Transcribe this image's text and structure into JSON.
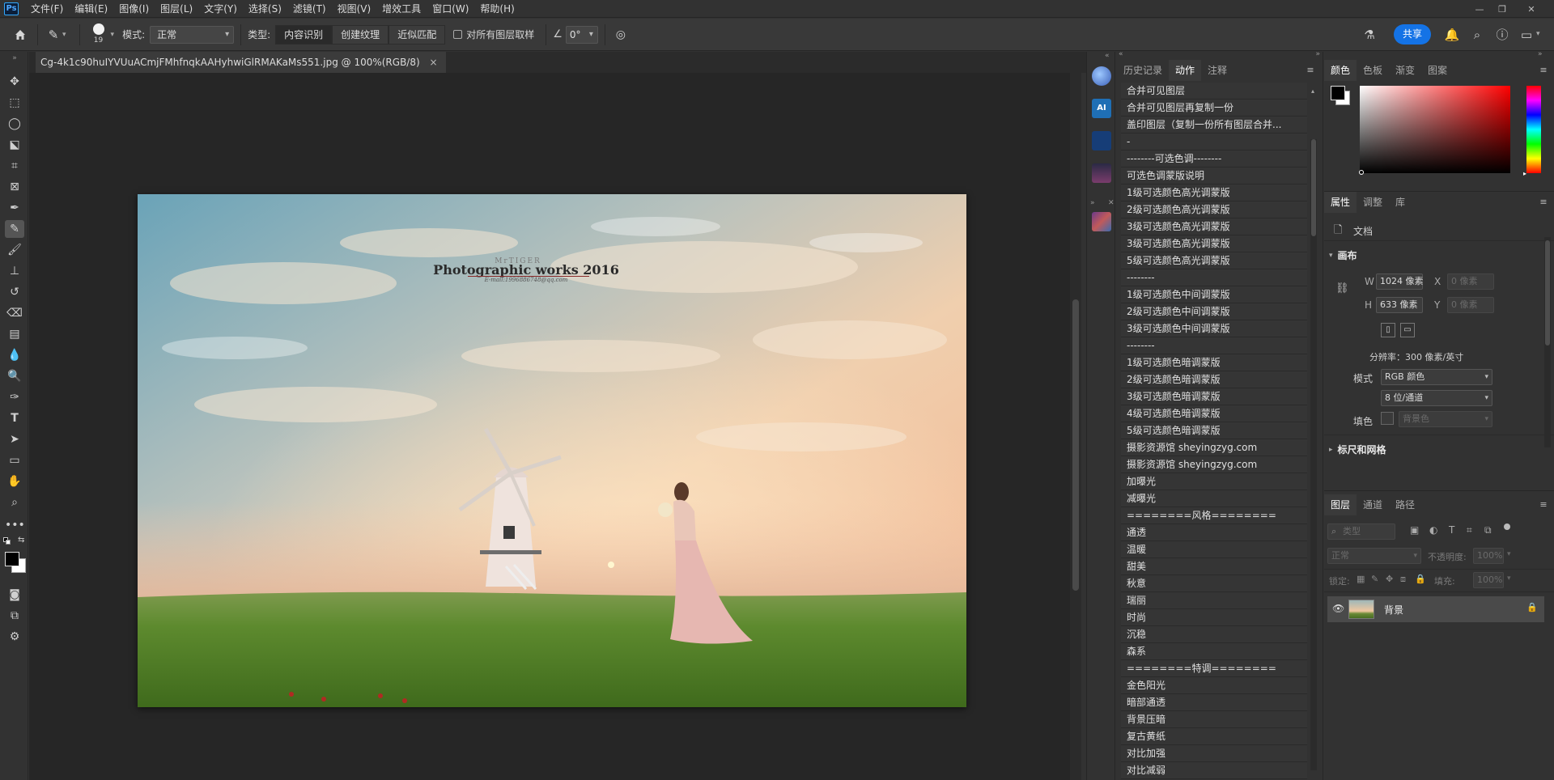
{
  "app": {
    "logo": "Ps",
    "menu": [
      "文件(F)",
      "编辑(E)",
      "图像(I)",
      "图层(L)",
      "文字(Y)",
      "选择(S)",
      "滤镜(T)",
      "视图(V)",
      "增效工具",
      "窗口(W)",
      "帮助(H)"
    ]
  },
  "options": {
    "brush_size": "19",
    "mode_label": "模式:",
    "mode_value": "正常",
    "type_label": "类型:",
    "type_buttons": [
      "内容识别",
      "创建纹理",
      "近似匹配"
    ],
    "sample_all_label": "对所有图层取样",
    "angle_value": "0°",
    "share_label": "共享"
  },
  "document": {
    "tab_title": "Cg-4k1c90huIYVUuACmjFMhfnqkAAHyhwiGlRMAKaMs551.jpg @ 100%(RGB/8)",
    "close_glyph": "×",
    "photo_title": "Photographic works 2016",
    "photo_subtitle": "MrTIGER",
    "photo_email": "E-mail:1996886748@qq.com"
  },
  "actions_panel": {
    "tabs": [
      "历史记录",
      "动作",
      "注释"
    ],
    "active_tab": 1,
    "items": [
      "合并可见图层",
      "合并可见图层再复制一份",
      "盖印图层（复制一份所有图层合并...",
      "-",
      "--------可选色调--------",
      "可选色调蒙版说明",
      "1级可选颜色高光调蒙版",
      "2级可选颜色高光调蒙版",
      "3级可选颜色高光调蒙版",
      "3级可选颜色高光调蒙版",
      "5级可选颜色高光调蒙版",
      "--------",
      "1级可选颜色中间调蒙版",
      "2级可选颜色中间调蒙版",
      "3级可选颜色中间调蒙版",
      "--------",
      "1级可选颜色暗调蒙版",
      "2级可选颜色暗调蒙版",
      "3级可选颜色暗调蒙版",
      "4级可选颜色暗调蒙版",
      "5级可选颜色暗调蒙版",
      "摄影资源馆 sheyingzyg.com",
      "摄影资源馆 sheyingzyg.com",
      "加曝光",
      "减曝光",
      "========风格========",
      "通透",
      "温暖",
      "甜美",
      "秋意",
      "瑞丽",
      "时尚",
      "沉稳",
      "森系",
      "========特调========",
      "金色阳光",
      "暗部通透",
      "背景压暗",
      "复古黄纸",
      "对比加强",
      "对比减弱"
    ]
  },
  "color_panel": {
    "tabs": [
      "颜色",
      "色板",
      "渐变",
      "图案"
    ],
    "foreground": "#000000",
    "background": "#ffffff",
    "hue": "#ff0000"
  },
  "properties_panel": {
    "tabs": [
      "属性",
      "调整",
      "库"
    ],
    "doc_label": "文档",
    "canvas_section": "画布",
    "w_label": "W",
    "w_value": "1024 像素",
    "h_label": "H",
    "h_value": "633 像素",
    "x_label": "X",
    "x_placeholder": "0 像素",
    "y_label": "Y",
    "y_placeholder": "0 像素",
    "resolution": "分辨率：300 像素/英寸",
    "mode_label": "模式",
    "mode_value": "RGB 颜色",
    "depth_value": "8 位/通道",
    "fill_label": "填色",
    "fill_value": "背景色",
    "rulers_section": "标尺和网格"
  },
  "layers_panel": {
    "tabs": [
      "图层",
      "通道",
      "路径"
    ],
    "search_placeholder": "类型",
    "blend_mode": "正常",
    "opacity_label": "不透明度:",
    "opacity_value": "100%",
    "lock_label": "锁定:",
    "fill_label": "填充:",
    "fill_value": "100%",
    "layers": [
      {
        "name": "背景",
        "visible": true,
        "locked": true
      }
    ]
  }
}
